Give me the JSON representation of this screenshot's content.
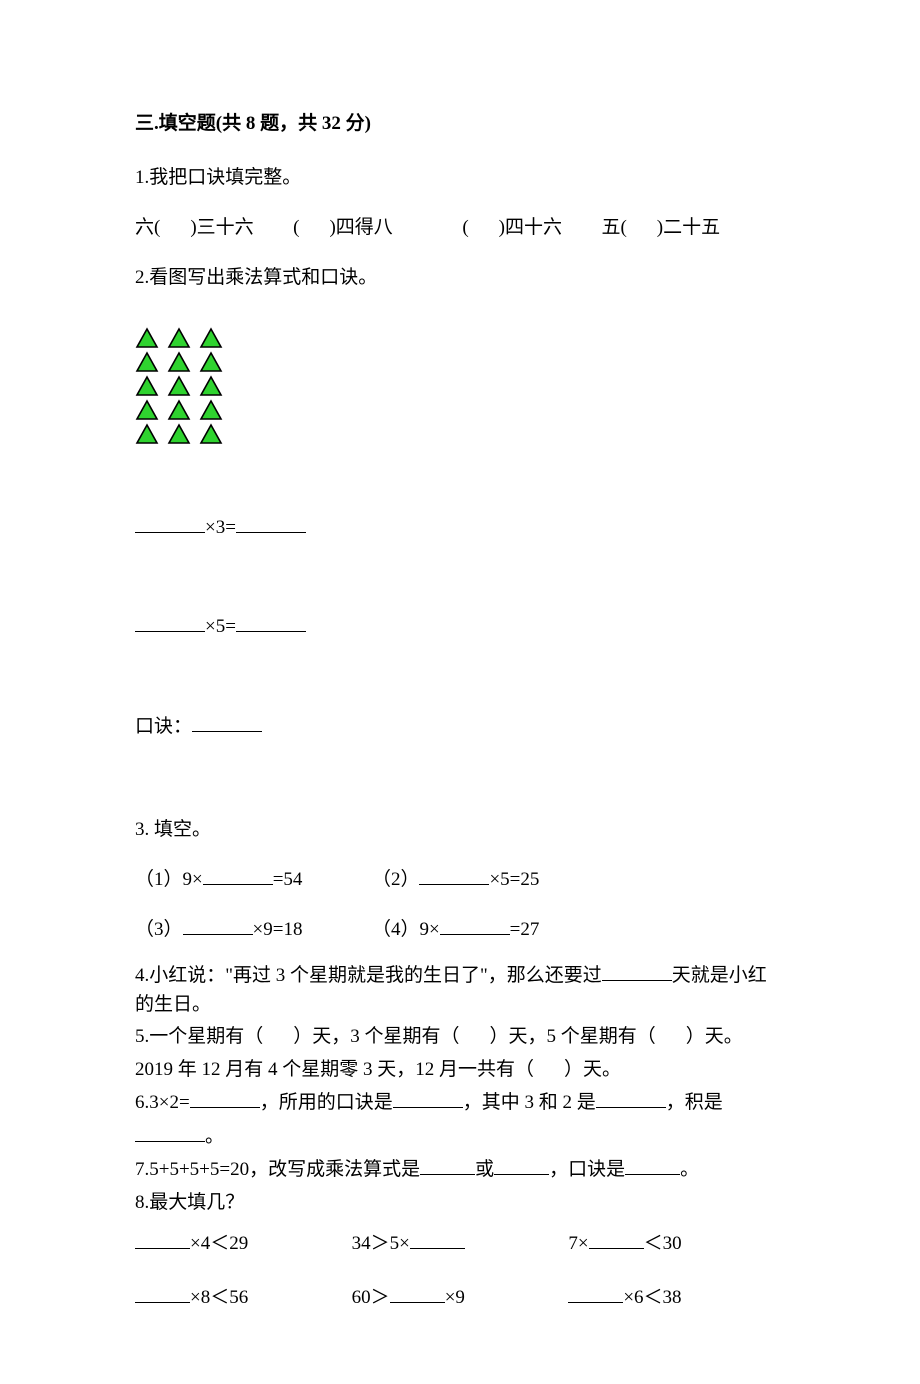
{
  "section": {
    "heading": "三.填空题(共 8 题，共 32 分)"
  },
  "q1": {
    "stem": "1.我把口诀填完整。",
    "p1a": "六(",
    "p1b": ")三十六",
    "p2a": "(",
    "p2b": ")四得八",
    "p3a": "(",
    "p3b": ")四十六",
    "p4a": "五(",
    "p4b": ")二十五"
  },
  "q2": {
    "stem": "2.看图写出乘法算式和口诀。",
    "eq1": "×3=",
    "eq2": "×5=",
    "koujue": "口诀："
  },
  "q3": {
    "stem": "3.  填空。",
    "s1a": "（1）9×",
    "s1b": "=54",
    "s2a": "（2）",
    "s2b": "×5=25",
    "s3a": "（3）",
    "s3b": "×9=18",
    "s4a": "（4）9×",
    "s4b": "=27"
  },
  "q4": {
    "a": "4.小红说：\"再过 3 个星期就是我的生日了\"，那么还要过",
    "b": "天就是小红的生日。"
  },
  "q5": {
    "a": "5.一个星期有（",
    "b": "）天，3 个星期有（",
    "c": "）天，5 个星期有（",
    "d": "）天。",
    "e": "2019 年 12 月有 4 个星期零 3 天，12 月一共有（",
    "f": "）天。"
  },
  "q6": {
    "a": "6.3×2=",
    "b": "，所用的口诀是",
    "c": "，其中 3 和 2 是",
    "d": "，积是",
    "e": "。"
  },
  "q7": {
    "a": "7.5+5+5+5=20，改写成乘法算式是",
    "b": "或",
    "c": "，口诀是",
    "d": "。"
  },
  "q8": {
    "stem": "8.最大填几？",
    "r1c1a": "",
    "r1c1b": "×4＜29",
    "r1c2a": "34＞5×",
    "r1c2b": "",
    "r1c3a": "7×",
    "r1c3b": "＜30",
    "r2c1a": "",
    "r2c1b": "×8＜56",
    "r2c2a": "60＞",
    "r2c2b": "×9",
    "r2c3a": "",
    "r2c3b": "×6＜38"
  }
}
